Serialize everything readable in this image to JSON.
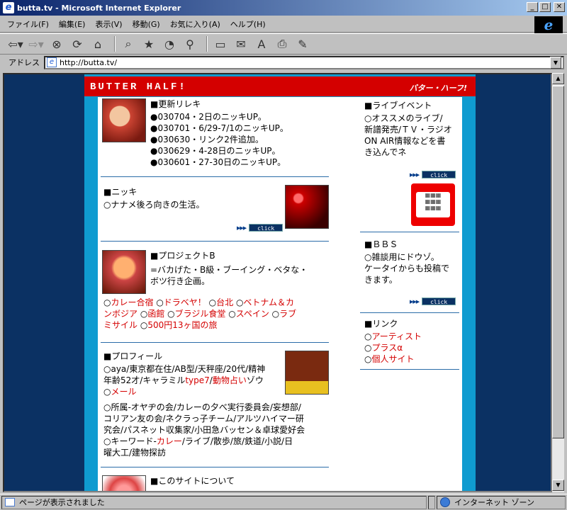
{
  "window": {
    "title": "butta.tv - Microsoft Internet Explorer"
  },
  "menu": [
    "ファイル(F)",
    "編集(E)",
    "表示(V)",
    "移動(G)",
    "お気に入り(A)",
    "ヘルプ(H)"
  ],
  "address": {
    "label": "アドレス",
    "url": "http://butta.tv/"
  },
  "status": {
    "left": "ページが表示されました",
    "zone": "インターネット ゾーン"
  },
  "banner": {
    "left": "BUTTER HALF!",
    "right": "バター・ハーフ!"
  },
  "updates": {
    "heading": "■更新リレキ",
    "items": [
      "●030704・2日のニッキUP。",
      "●030701・6/29-7/1のニッキUP。",
      "●030630・リンク2件追加。",
      "●030629・4-28日のニッキUP。",
      "●030601・27-30日のニッキUP。"
    ]
  },
  "nikki": {
    "heading": "■ニッキ",
    "desc": "○ナナメ後ろ向きの生活。",
    "click": "click"
  },
  "project": {
    "heading": "■プロジェクトB",
    "desc1": "=バカげた・B級・ブーイング・ベタな・",
    "desc2": "ボツ行き企画。",
    "line1_a": "○",
    "line1_b": "カレー合宿",
    "line1_c": "  ○",
    "line1_d": "ドラベヤ！",
    "line1_e": "  ○",
    "line1_f": "台北",
    "line1_g": "  ○",
    "line1_h": "ベトナム＆カ",
    "line2_a": "ンボジア",
    "line2_b": "  ○",
    "line2_c": "函館",
    "line2_d": "  ○",
    "line2_e": "ブラジル食堂",
    "line2_f": "  ○",
    "line2_g": "スペイン",
    "line2_h": "  ○",
    "line2_i": "ラブ",
    "line3_a": "ミサイル",
    "line3_b": "  ○",
    "line3_c": "500円13ヶ国の旅"
  },
  "profile": {
    "heading": "■プロフィール",
    "l1": "○aya/東京都在住/AB型/天秤座/20代/精神",
    "l2a": "年齢52才/キャラミル",
    "l2b": "type7",
    "l2c": "/",
    "l2d": "動物占い",
    "l2e": "ゾウ",
    "l3a": "○",
    "l3b": "メール",
    "l4": "○所属-オヤヂの会/カレーの夕べ実行委員会/妄想部/",
    "l5": "コリアン友の会/ネクラっ子チーム/アルツハイマー研",
    "l6": "究会/パスネット収集家/小田急バッセン＆卓球愛好会",
    "l7a": "○キーワード-",
    "l7b": "カレー",
    "l7c": "/ライブ/散歩/旅/鉄道/小説/日",
    "l8": "曜大工/建物探訪"
  },
  "about": {
    "heading": "■このサイトについて"
  },
  "live": {
    "heading": "■ライブイベント",
    "l1": "○オススメのライブ/",
    "l2": "新譜発売/ＴＶ・ラジオ",
    "l3": "ON AIR情報などを書",
    "l4": "き込んでネ",
    "click": "click"
  },
  "bbs": {
    "heading": "■ＢＢＳ",
    "l1": "○雑談用にドウゾ。",
    "l2": "ケータイからも投稿で",
    "l3": "きます。",
    "click": "click"
  },
  "links": {
    "heading": "■リンク",
    "items": [
      "アーティスト",
      "プラスα",
      "個人サイト"
    ]
  },
  "colors": {
    "outer_bg": "#0b3163",
    "frame": "#0f9bd0",
    "banner": "#d40000",
    "link": "#d40000"
  }
}
